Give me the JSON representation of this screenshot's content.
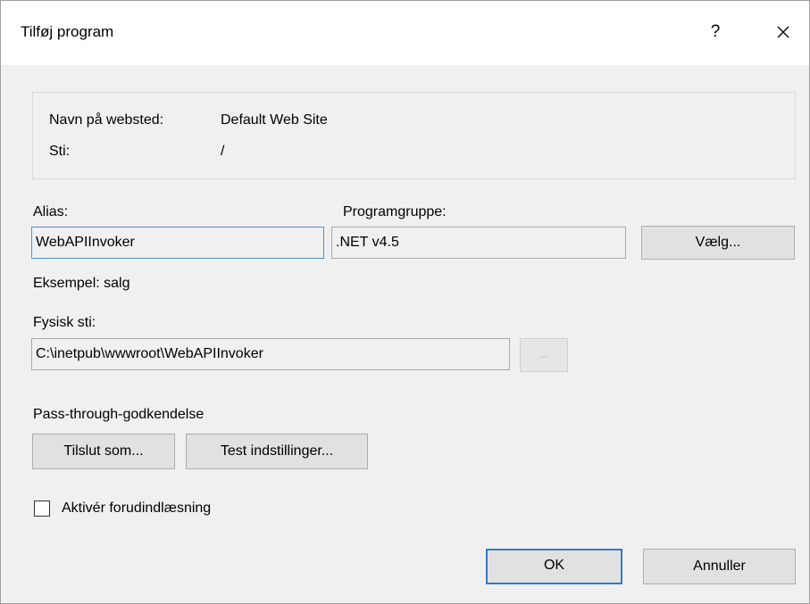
{
  "window": {
    "title": "Tilføj program",
    "help_label": "?",
    "close_icon": "close-icon"
  },
  "site_info": {
    "site_name_label": "Navn på websted:",
    "site_name_value": "Default Web Site",
    "path_label": "Sti:",
    "path_value": "/"
  },
  "alias": {
    "label": "Alias:",
    "value": "WebAPIInvoker",
    "example": "Eksempel: salg"
  },
  "app_pool": {
    "label": "Programgruppe:",
    "value": ".NET v4.5",
    "select_button": "Vælg..."
  },
  "physical_path": {
    "label": "Fysisk sti:",
    "value": "C:\\inetpub\\wwwroot\\WebAPIInvoker",
    "browse_button": "..."
  },
  "pass_through": {
    "label": "Pass-through-godkendelse",
    "connect_as_button": "Tilslut som...",
    "test_settings_button": "Test indstillinger..."
  },
  "preload": {
    "label": "Aktivér forudindlæsning",
    "checked": false
  },
  "footer": {
    "ok_button": "OK",
    "cancel_button": "Annuller"
  },
  "colors": {
    "focus_border": "#4a90d9",
    "default_button_border": "#2e7bcf",
    "dialog_background": "#f0f0f0"
  }
}
